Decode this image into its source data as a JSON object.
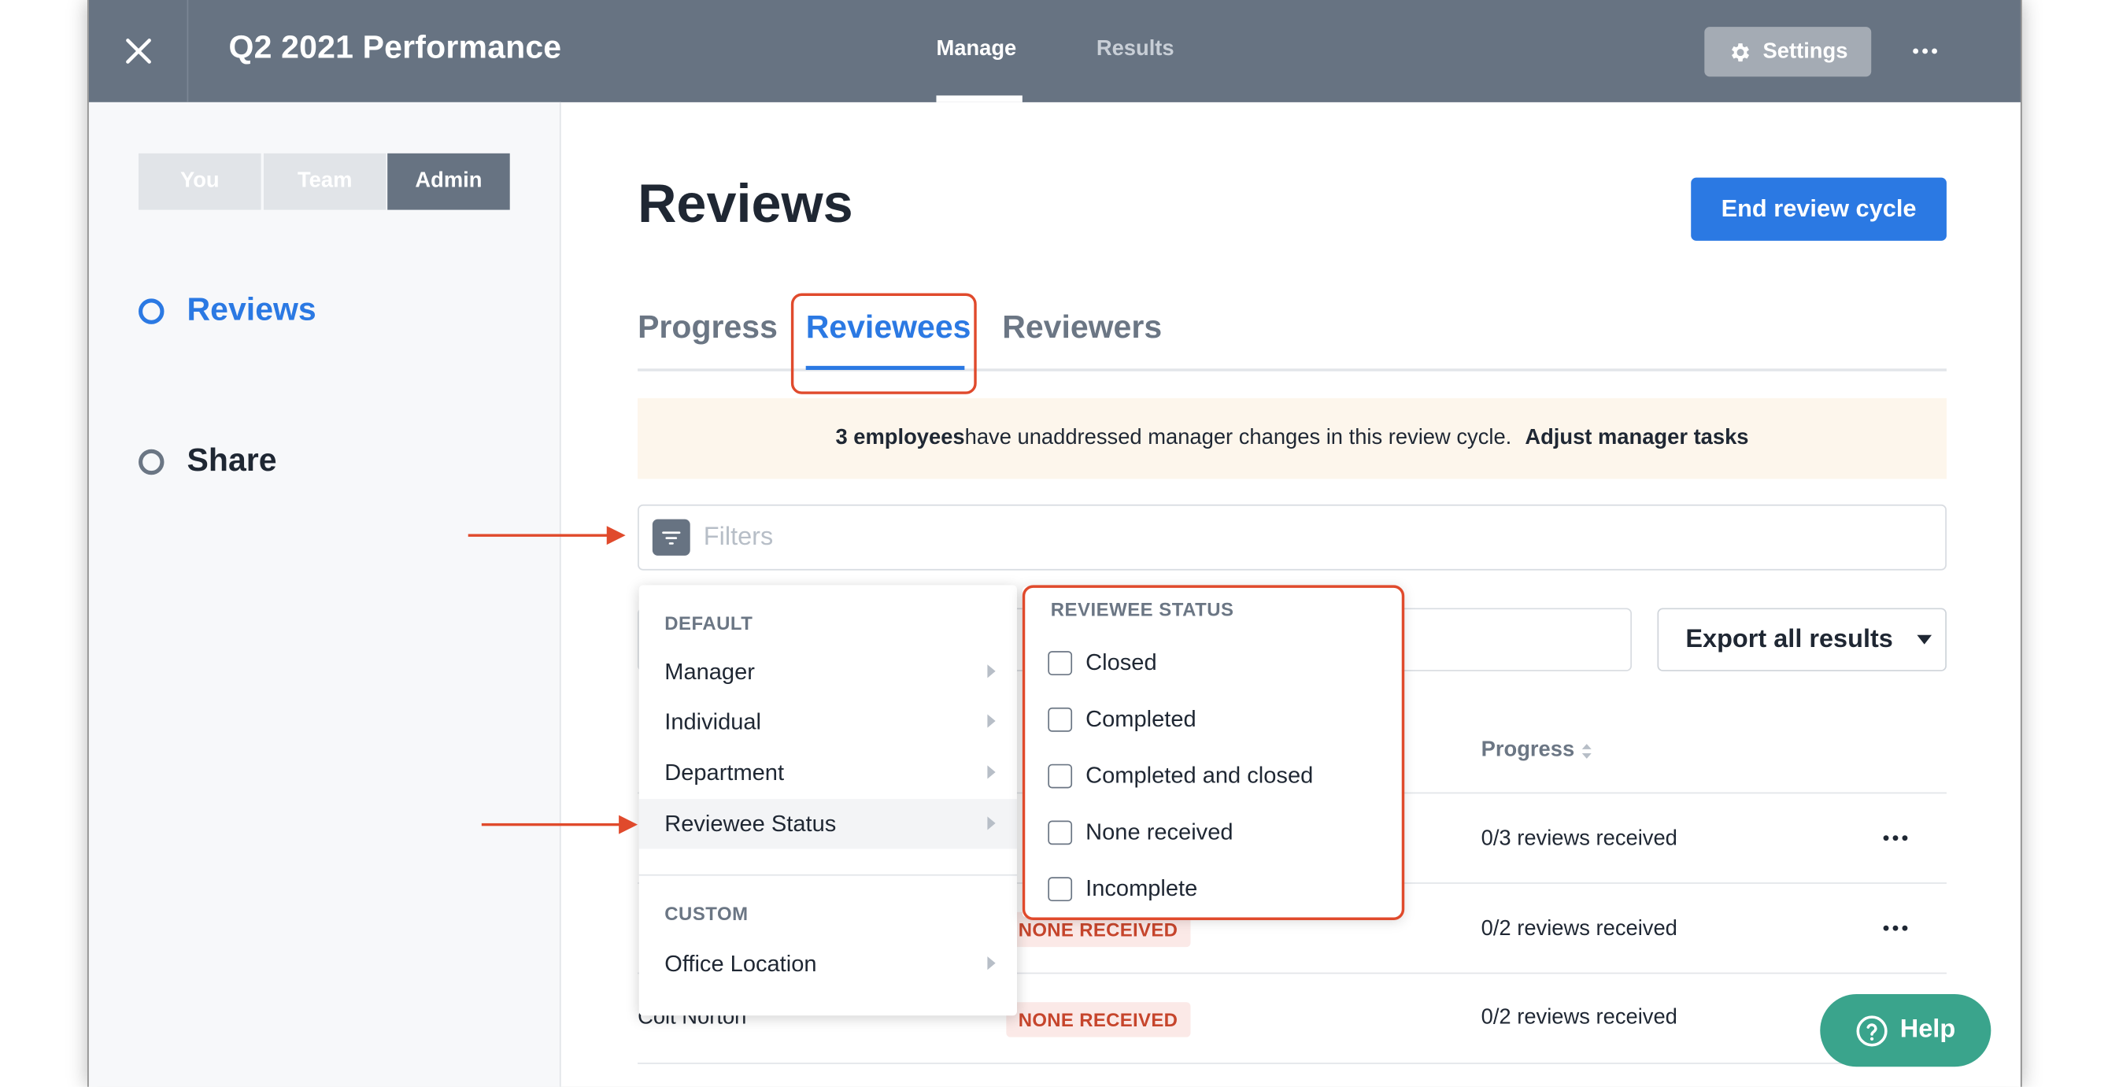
{
  "header": {
    "title": "Q2 2021 Performance",
    "tabs": [
      {
        "label": "Manage",
        "active": true
      },
      {
        "label": "Results",
        "active": false
      }
    ],
    "settings_label": "Settings",
    "more_icon": "more-horizontal-icon"
  },
  "sidebar": {
    "segments": [
      "You",
      "Team",
      "Admin"
    ],
    "active_segment": "Admin",
    "items": [
      {
        "label": "Reviews",
        "active": true
      },
      {
        "label": "Share",
        "active": false
      }
    ]
  },
  "main": {
    "title": "Reviews",
    "end_button": "End review cycle",
    "tabs": [
      "Progress",
      "Reviewees",
      "Reviewers"
    ],
    "active_tab": "Reviewees",
    "banner": {
      "bold_lead": "3 employees",
      "text": " have unaddressed manager changes in this review cycle.",
      "action": "Adjust manager tasks"
    },
    "filters_placeholder": "Filters",
    "export_label": "Export all results",
    "table": {
      "progress_header": "Progress",
      "rows": [
        {
          "name": "",
          "status": "",
          "progress": "0/3 reviews received"
        },
        {
          "name": "",
          "status": "NONE RECEIVED",
          "progress": "0/2 reviews received"
        },
        {
          "name": "Colt Norton",
          "status": "NONE RECEIVED",
          "progress": "0/2 reviews received"
        }
      ]
    }
  },
  "filter_menu": {
    "default_heading": "DEFAULT",
    "default_items": [
      "Manager",
      "Individual",
      "Department",
      "Reviewee Status"
    ],
    "highlighted_item": "Reviewee Status",
    "custom_heading": "CUSTOM",
    "custom_items": [
      "Office Location"
    ]
  },
  "status_menu": {
    "heading": "REVIEWEE STATUS",
    "options": [
      {
        "label": "Closed",
        "checked": false
      },
      {
        "label": "Completed",
        "checked": false
      },
      {
        "label": "Completed and closed",
        "checked": false
      },
      {
        "label": "None received",
        "checked": false
      },
      {
        "label": "Incomplete",
        "checked": false
      }
    ]
  },
  "help_label": "Help",
  "colors": {
    "header_bg": "#677382",
    "accent_blue": "#2b79e3",
    "annotation_red": "#e04a2c",
    "help_green": "#3aa48c",
    "badge_text": "#c6452c"
  }
}
